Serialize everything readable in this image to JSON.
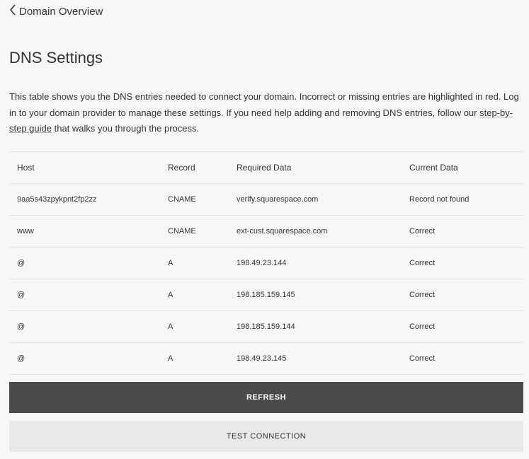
{
  "nav": {
    "back_label": "Domain Overview"
  },
  "page": {
    "title": "DNS Settings"
  },
  "intro": {
    "text": "This table shows you the DNS entries needed to connect your domain. Incorrect or missing entries are highlighted in red. Log in to your domain provider to manage these settings. If you need help adding and removing DNS entries, follow our ",
    "link": "step-by-step guide",
    "suffix": " that walks you through the process."
  },
  "table": {
    "headers": [
      "Host",
      "Record",
      "Required Data",
      "Current Data"
    ],
    "rows": [
      {
        "host": "9aa5s43zpykpnt2fp2zz",
        "record": "CNAME",
        "required": "verify.squarespace.com",
        "current": "Record not found",
        "ok": false
      },
      {
        "host": "www",
        "record": "CNAME",
        "required": "ext-cust.squarespace.com",
        "current": "Correct",
        "ok": true
      },
      {
        "host": "@",
        "record": "A",
        "required": "198.49.23.144",
        "current": "Correct",
        "ok": true
      },
      {
        "host": "@",
        "record": "A",
        "required": "198.185.159.145",
        "current": "Correct",
        "ok": true
      },
      {
        "host": "@",
        "record": "A",
        "required": "198.185.159.144",
        "current": "Correct",
        "ok": true
      },
      {
        "host": "@",
        "record": "A",
        "required": "198.49.23.145",
        "current": "Correct",
        "ok": true
      }
    ]
  },
  "buttons": {
    "refresh": "REFRESH",
    "test": "TEST CONNECTION"
  },
  "colors": {
    "ok": "#3fbf85",
    "error": "#e5534b",
    "primary_button": "#4a4a49"
  }
}
